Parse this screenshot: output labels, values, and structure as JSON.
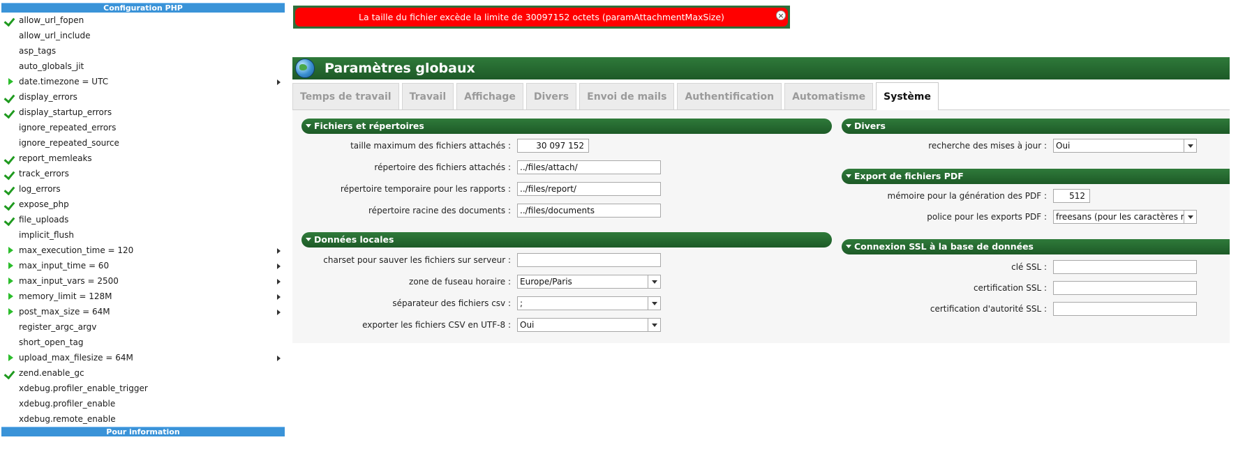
{
  "php_panel": {
    "header": "Configuration PHP",
    "footer": "Pour information",
    "items": [
      {
        "label": "allow_url_fopen",
        "marker": "check",
        "submenu": false
      },
      {
        "label": "allow_url_include",
        "marker": "none",
        "submenu": false
      },
      {
        "label": "asp_tags",
        "marker": "none",
        "submenu": false
      },
      {
        "label": "auto_globals_jit",
        "marker": "none",
        "submenu": false
      },
      {
        "label": "date.timezone = UTC",
        "marker": "play",
        "submenu": true
      },
      {
        "label": "display_errors",
        "marker": "check",
        "submenu": false
      },
      {
        "label": "display_startup_errors",
        "marker": "check",
        "submenu": false
      },
      {
        "label": "ignore_repeated_errors",
        "marker": "none",
        "submenu": false
      },
      {
        "label": "ignore_repeated_source",
        "marker": "none",
        "submenu": false
      },
      {
        "label": "report_memleaks",
        "marker": "check",
        "submenu": false
      },
      {
        "label": "track_errors",
        "marker": "check",
        "submenu": false
      },
      {
        "label": "log_errors",
        "marker": "check",
        "submenu": false
      },
      {
        "label": "expose_php",
        "marker": "check",
        "submenu": false
      },
      {
        "label": "file_uploads",
        "marker": "check",
        "submenu": false
      },
      {
        "label": "implicit_flush",
        "marker": "none",
        "submenu": false
      },
      {
        "label": "max_execution_time = 120",
        "marker": "play",
        "submenu": true
      },
      {
        "label": "max_input_time = 60",
        "marker": "play",
        "submenu": true
      },
      {
        "label": "max_input_vars = 2500",
        "marker": "play",
        "submenu": true
      },
      {
        "label": "memory_limit = 128M",
        "marker": "play",
        "submenu": true
      },
      {
        "label": "post_max_size = 64M",
        "marker": "play",
        "submenu": true
      },
      {
        "label": "register_argc_argv",
        "marker": "none",
        "submenu": false
      },
      {
        "label": "short_open_tag",
        "marker": "none",
        "submenu": false
      },
      {
        "label": "upload_max_filesize = 64M",
        "marker": "play",
        "submenu": true
      },
      {
        "label": "zend.enable_gc",
        "marker": "check",
        "submenu": false
      },
      {
        "label": "xdebug.profiler_enable_trigger",
        "marker": "none",
        "submenu": false
      },
      {
        "label": "xdebug.profiler_enable",
        "marker": "none",
        "submenu": false
      },
      {
        "label": "xdebug.remote_enable",
        "marker": "none",
        "submenu": false
      }
    ]
  },
  "error": {
    "message": "La taille du fichier excède la limite de 30097152 octets (paramAttachmentMaxSize)",
    "close_glyph": "×"
  },
  "page": {
    "title": "Paramètres globaux"
  },
  "tabs": [
    {
      "label": "Temps de travail",
      "active": false
    },
    {
      "label": "Travail",
      "active": false
    },
    {
      "label": "Affichage",
      "active": false
    },
    {
      "label": "Divers",
      "active": false
    },
    {
      "label": "Envoi de mails",
      "active": false
    },
    {
      "label": "Authentification",
      "active": false
    },
    {
      "label": "Automatisme",
      "active": false
    },
    {
      "label": "Système",
      "active": true
    }
  ],
  "sections": {
    "files": {
      "title": "Fichiers et répertoires",
      "max_size_label": "taille maximum des fichiers attachés :",
      "max_size_value": "30 097 152",
      "attach_dir_label": "répertoire des fichiers attachés :",
      "attach_dir_value": "../files/attach/",
      "report_dir_label": "répertoire temporaire pour les rapports :",
      "report_dir_value": "../files/report/",
      "docs_dir_label": "répertoire racine des documents :",
      "docs_dir_value": "../files/documents"
    },
    "local": {
      "title": "Données locales",
      "charset_label": "charset pour sauver les fichiers sur serveur :",
      "charset_value": "",
      "timezone_label": "zone de fuseau horaire :",
      "timezone_value": "Europe/Paris",
      "csv_sep_label": "séparateur des fichiers csv :",
      "csv_sep_value": ";",
      "csv_utf8_label": "exporter les fichiers CSV en UTF-8 :",
      "csv_utf8_value": "Oui"
    },
    "misc": {
      "title": "Divers",
      "updates_label": "recherche des mises à jour :",
      "updates_value": "Oui"
    },
    "pdf": {
      "title": "Export de fichiers PDF",
      "memory_label": "mémoire pour la génération des PDF :",
      "memory_value": "512",
      "font_label": "police pour les exports PDF :",
      "font_value": "freesans (pour les caractères non latins)"
    },
    "ssl": {
      "title": "Connexion SSL à la base de données",
      "key_label": "clé SSL :",
      "key_value": "",
      "cert_label": "certification SSL :",
      "cert_value": "",
      "ca_label": "certification d'autorité SSL :",
      "ca_value": ""
    }
  }
}
